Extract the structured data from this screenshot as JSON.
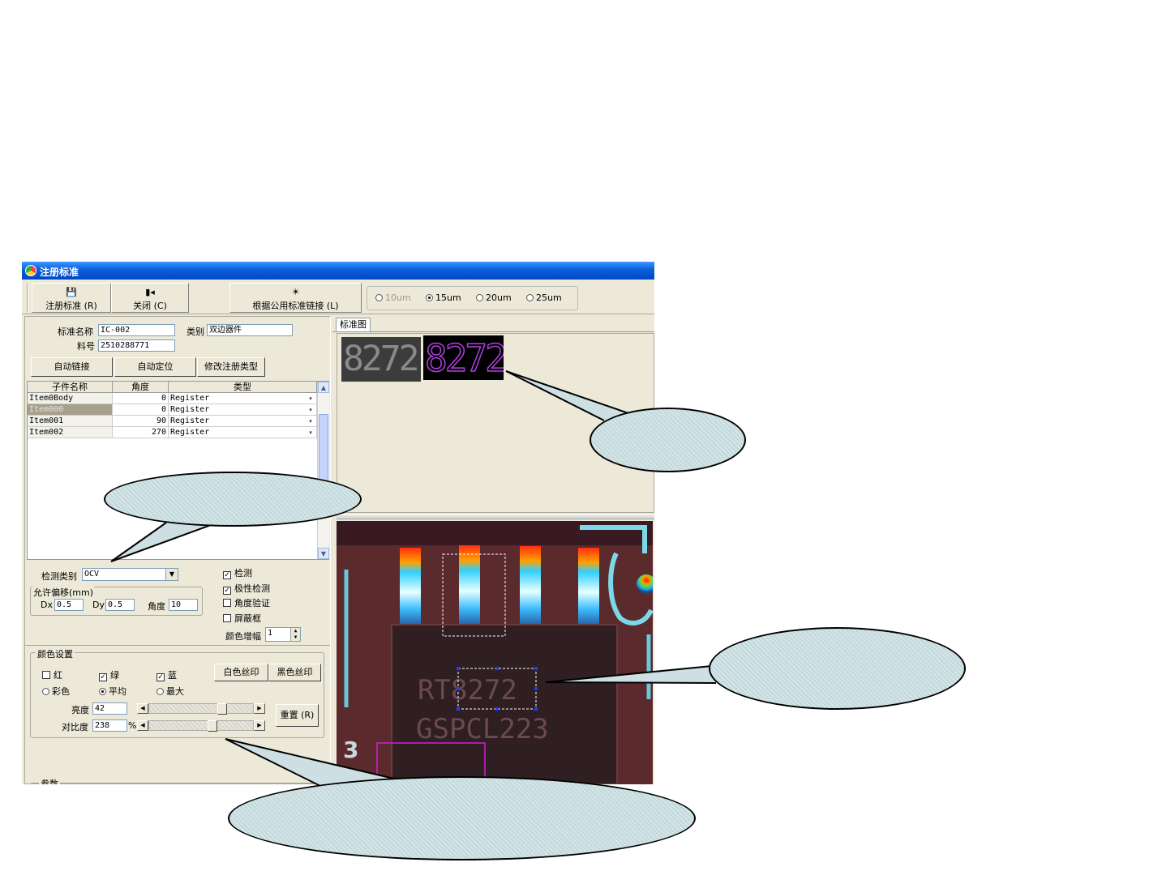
{
  "window": {
    "title": "注册标准",
    "toolbar": {
      "register_label": "注册标准 (R)",
      "close_label": "关闭 (C)",
      "link_label": "根据公用标准链接 (L)",
      "resolutions": [
        "10um",
        "15um",
        "20um",
        "25um"
      ],
      "selected_resolution": "15um"
    },
    "form": {
      "std_name_label": "标准名称",
      "std_name": "IC-002",
      "category_label": "类别",
      "category": "双边器件",
      "part_no_label": "料号",
      "part_no": "2510288771",
      "auto_link_label": "自动链接",
      "auto_locate_label": "自动定位",
      "modify_type_label": "修改注册类型"
    },
    "table": {
      "headers": [
        "子件名称",
        "角度",
        "类型"
      ],
      "rows": [
        {
          "name": "Item0Body",
          "angle": "0",
          "type": "Register"
        },
        {
          "name": "Item000",
          "angle": "0",
          "type": "Register"
        },
        {
          "name": "Item001",
          "angle": "90",
          "type": "Register"
        },
        {
          "name": "Item002",
          "angle": "270",
          "type": "Register"
        }
      ],
      "selected_row": 1
    },
    "detect": {
      "type_label": "检测类别",
      "type_value": "OCV",
      "offset_group_label": "允许偏移(mm)",
      "dx_label": "Dx",
      "dx": "0.5",
      "dy_label": "Dy",
      "dy": "0.5",
      "angle_label": "角度",
      "angle": "10",
      "checks": [
        {
          "label": "检测",
          "checked": true
        },
        {
          "label": "极性检测",
          "checked": true
        },
        {
          "label": "角度验证",
          "checked": false
        },
        {
          "label": "屏蔽框",
          "checked": false
        }
      ],
      "gain_label": "颜色增幅",
      "gain": "1"
    },
    "color": {
      "group_label": "颜色设置",
      "channels": [
        {
          "label": "红",
          "checked": false
        },
        {
          "label": "绿",
          "checked": true
        },
        {
          "label": "蓝",
          "checked": true
        }
      ],
      "white_label": "白色丝印",
      "black_label": "黑色丝印",
      "modes": [
        {
          "label": "彩色",
          "selected": false
        },
        {
          "label": "平均",
          "selected": true
        },
        {
          "label": "最大",
          "selected": false
        }
      ],
      "brightness_label": "亮度",
      "brightness": "42",
      "contrast_label": "对比度",
      "contrast": "238",
      "percent": "%",
      "reset_label": "重置 (R)",
      "brightness_level": 0.72,
      "contrast_level": 0.62
    },
    "params_label": "参数",
    "tab_label": "标准图",
    "thumbnail_text": "8272",
    "chip_marking": [
      "RT8272",
      "GSPCL223"
    ],
    "board_digit": "3"
  }
}
